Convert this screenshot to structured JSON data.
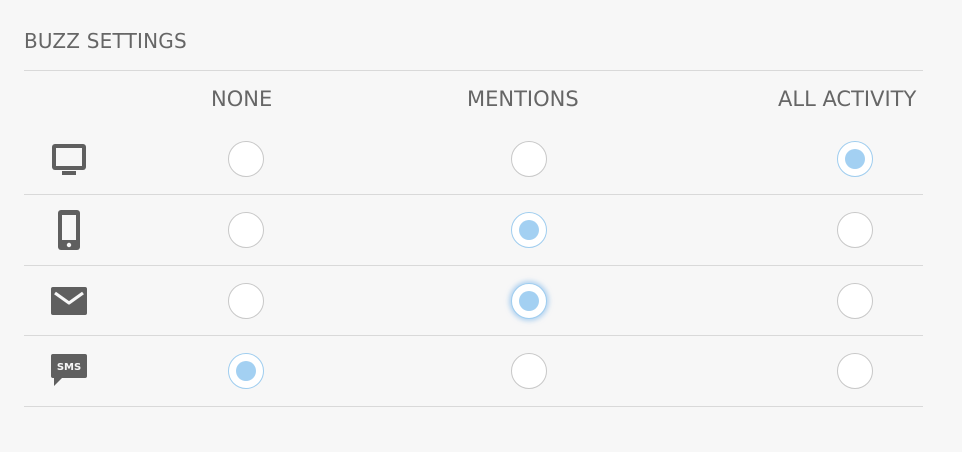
{
  "settings": {
    "title": "BUZZ SETTINGS",
    "columns": [
      "NONE",
      "MENTIONS",
      "ALL ACTIVITY"
    ],
    "rows": [
      {
        "channel": "desktop",
        "icon": "monitor-icon",
        "selected": "ALL ACTIVITY"
      },
      {
        "channel": "mobile",
        "icon": "mobile-phone-icon",
        "selected": "MENTIONS"
      },
      {
        "channel": "email",
        "icon": "envelope-icon",
        "selected": "MENTIONS",
        "focused": true
      },
      {
        "channel": "sms",
        "icon": "sms-icon",
        "selected": "NONE",
        "icon_text": "SMS"
      }
    ]
  },
  "colors": {
    "background": "#f7f7f7",
    "text": "#666666",
    "icon": "#5f5f5f",
    "radio_border": "#c8c8c8",
    "radio_selected_fill": "#a3d0f2",
    "divider": "#d9d9d9"
  }
}
